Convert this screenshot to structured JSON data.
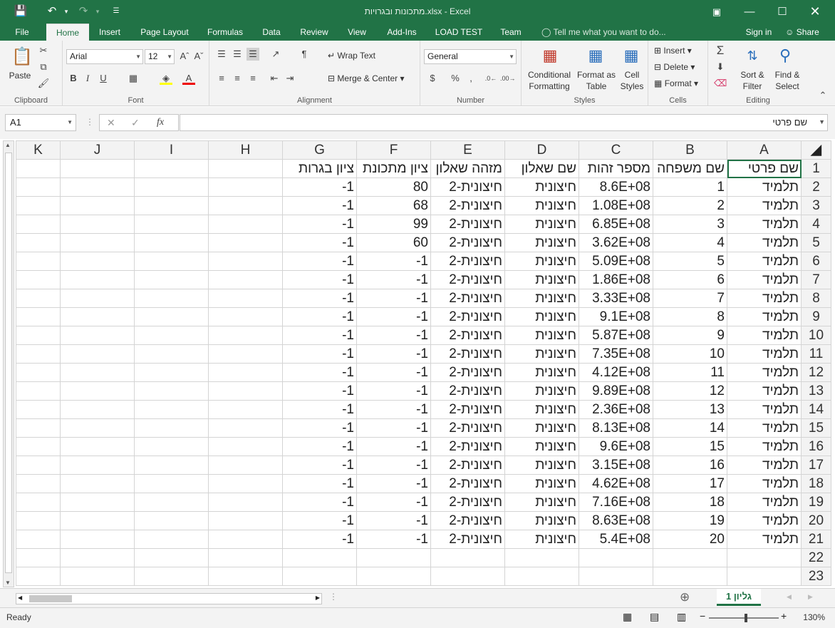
{
  "window": {
    "title": "מתכונות ובגרויות.xlsx - Excel",
    "icons": [
      "save-icon",
      "undo-icon",
      "redo-icon",
      "customize-qat-icon",
      "ribbon-display-icon",
      "minimize-icon",
      "restore-icon",
      "close-icon"
    ]
  },
  "tabs": [
    {
      "label": "File"
    },
    {
      "label": "Home"
    },
    {
      "label": "Insert"
    },
    {
      "label": "Page Layout"
    },
    {
      "label": "Formulas"
    },
    {
      "label": "Data"
    },
    {
      "label": "Review"
    },
    {
      "label": "View"
    },
    {
      "label": "Add-Ins"
    },
    {
      "label": "LOAD TEST"
    },
    {
      "label": "Team"
    }
  ],
  "tellme": "Tell me what you want to do...",
  "account": {
    "signin": "Sign in",
    "share": "Share"
  },
  "ribbon": {
    "clipboard": {
      "label": "Clipboard",
      "paste": "Paste"
    },
    "font": {
      "label": "Font",
      "name": "Arial",
      "size": "12",
      "bold": "B",
      "italic": "I",
      "underline": "U"
    },
    "alignment": {
      "label": "Alignment",
      "wrap": "Wrap Text",
      "merge": "Merge & Center"
    },
    "number": {
      "label": "Number",
      "format": "General",
      "currency": "$",
      "percent": "%",
      "comma": ","
    },
    "styles": {
      "label": "Styles",
      "conditional": "Conditional",
      "conditional2": "Formatting",
      "formatas": "Format as",
      "formatas2": "Table",
      "cell": "Cell",
      "cell2": "Styles"
    },
    "cells": {
      "label": "Cells",
      "insert": "Insert",
      "delete": "Delete",
      "format": "Format"
    },
    "editing": {
      "label": "Editing",
      "sort": "Sort &",
      "sort2": "Filter",
      "find": "Find &",
      "find2": "Select"
    }
  },
  "formula": {
    "namebox": "A1",
    "fx": "fx",
    "value": "שם פרטי"
  },
  "columns": [
    "K",
    "J",
    "I",
    "H",
    "G",
    "F",
    "E",
    "D",
    "C",
    "B",
    "A"
  ],
  "header_row": [
    "שם פרטי",
    "שם משפחה",
    "מספר זהות",
    "שם שאלון",
    "מזהה שאלון",
    "ציון מתכונת",
    "ציון בגרות"
  ],
  "rows": [
    {
      "n": "2",
      "A": "תלמיד",
      "B": "1",
      "C": "8.6E+08",
      "D": "חיצונית",
      "E": "חיצונית-2",
      "F": "80",
      "G": "-1"
    },
    {
      "n": "3",
      "A": "תלמיד",
      "B": "2",
      "C": "1.08E+08",
      "D": "חיצונית",
      "E": "חיצונית-2",
      "F": "68",
      "G": "-1"
    },
    {
      "n": "4",
      "A": "תלמיד",
      "B": "3",
      "C": "6.85E+08",
      "D": "חיצונית",
      "E": "חיצונית-2",
      "F": "99",
      "G": "-1"
    },
    {
      "n": "5",
      "A": "תלמיד",
      "B": "4",
      "C": "3.62E+08",
      "D": "חיצונית",
      "E": "חיצונית-2",
      "F": "60",
      "G": "-1"
    },
    {
      "n": "6",
      "A": "תלמיד",
      "B": "5",
      "C": "5.09E+08",
      "D": "חיצונית",
      "E": "חיצונית-2",
      "F": "-1",
      "G": "-1"
    },
    {
      "n": "7",
      "A": "תלמיד",
      "B": "6",
      "C": "1.86E+08",
      "D": "חיצונית",
      "E": "חיצונית-2",
      "F": "-1",
      "G": "-1"
    },
    {
      "n": "8",
      "A": "תלמיד",
      "B": "7",
      "C": "3.33E+08",
      "D": "חיצונית",
      "E": "חיצונית-2",
      "F": "-1",
      "G": "-1"
    },
    {
      "n": "9",
      "A": "תלמיד",
      "B": "8",
      "C": "9.1E+08",
      "D": "חיצונית",
      "E": "חיצונית-2",
      "F": "-1",
      "G": "-1"
    },
    {
      "n": "10",
      "A": "תלמיד",
      "B": "9",
      "C": "5.87E+08",
      "D": "חיצונית",
      "E": "חיצונית-2",
      "F": "-1",
      "G": "-1"
    },
    {
      "n": "11",
      "A": "תלמיד",
      "B": "10",
      "C": "7.35E+08",
      "D": "חיצונית",
      "E": "חיצונית-2",
      "F": "-1",
      "G": "-1"
    },
    {
      "n": "12",
      "A": "תלמיד",
      "B": "11",
      "C": "4.12E+08",
      "D": "חיצונית",
      "E": "חיצונית-2",
      "F": "-1",
      "G": "-1"
    },
    {
      "n": "13",
      "A": "תלמיד",
      "B": "12",
      "C": "9.89E+08",
      "D": "חיצונית",
      "E": "חיצונית-2",
      "F": "-1",
      "G": "-1"
    },
    {
      "n": "14",
      "A": "תלמיד",
      "B": "13",
      "C": "2.36E+08",
      "D": "חיצונית",
      "E": "חיצונית-2",
      "F": "-1",
      "G": "-1"
    },
    {
      "n": "15",
      "A": "תלמיד",
      "B": "14",
      "C": "8.13E+08",
      "D": "חיצונית",
      "E": "חיצונית-2",
      "F": "-1",
      "G": "-1"
    },
    {
      "n": "16",
      "A": "תלמיד",
      "B": "15",
      "C": "9.6E+08",
      "D": "חיצונית",
      "E": "חיצונית-2",
      "F": "-1",
      "G": "-1"
    },
    {
      "n": "17",
      "A": "תלמיד",
      "B": "16",
      "C": "3.15E+08",
      "D": "חיצונית",
      "E": "חיצונית-2",
      "F": "-1",
      "G": "-1"
    },
    {
      "n": "18",
      "A": "תלמיד",
      "B": "17",
      "C": "4.62E+08",
      "D": "חיצונית",
      "E": "חיצונית-2",
      "F": "-1",
      "G": "-1"
    },
    {
      "n": "19",
      "A": "תלמיד",
      "B": "18",
      "C": "7.16E+08",
      "D": "חיצונית",
      "E": "חיצונית-2",
      "F": "-1",
      "G": "-1"
    },
    {
      "n": "20",
      "A": "תלמיד",
      "B": "19",
      "C": "8.63E+08",
      "D": "חיצונית",
      "E": "חיצונית-2",
      "F": "-1",
      "G": "-1"
    },
    {
      "n": "21",
      "A": "תלמיד",
      "B": "20",
      "C": "5.4E+08",
      "D": "חיצונית",
      "E": "חיצונית-2",
      "F": "-1",
      "G": "-1"
    }
  ],
  "empty_rows": [
    "22",
    "23"
  ],
  "sheet_tab": "גליון 1",
  "status": {
    "ready": "Ready",
    "zoom": "130%"
  },
  "colors": {
    "accent": "#217346",
    "ribbon": "#f3f3f3",
    "gridline": "#d4d4d4"
  }
}
